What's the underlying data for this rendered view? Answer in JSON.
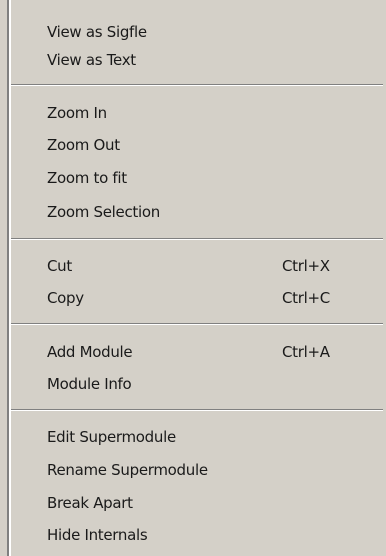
{
  "menu": {
    "groups": [
      {
        "items": [
          {
            "label": "View as Sigfle"
          },
          {
            "label": "View as Text"
          }
        ]
      },
      {
        "items": [
          {
            "label": "Zoom In"
          },
          {
            "label": "Zoom Out"
          },
          {
            "label": "Zoom to fit"
          },
          {
            "label": "Zoom Selection"
          }
        ]
      },
      {
        "items": [
          {
            "label": "Cut",
            "shortcut": "Ctrl+X"
          },
          {
            "label": "Copy",
            "shortcut": "Ctrl+C"
          }
        ]
      },
      {
        "items": [
          {
            "label": "Add Module",
            "shortcut": "Ctrl+A"
          },
          {
            "label": "Module Info"
          }
        ]
      },
      {
        "items": [
          {
            "label": "Edit Supermodule"
          },
          {
            "label": "Rename Supermodule"
          },
          {
            "label": "Break Apart"
          },
          {
            "label": "Hide Internals"
          }
        ]
      }
    ]
  }
}
